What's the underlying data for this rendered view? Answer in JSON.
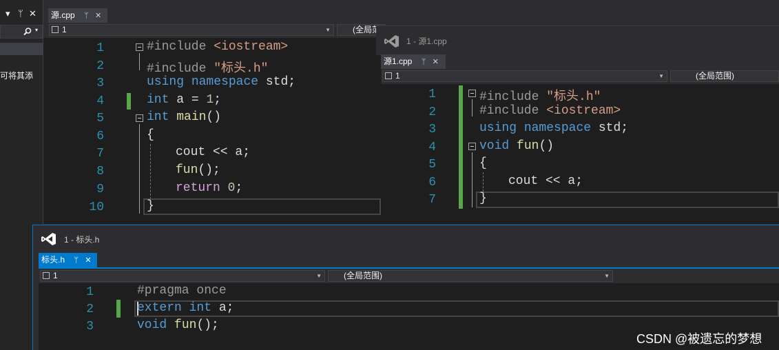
{
  "left_panel": {
    "header_icons": [
      "▾",
      "ᛘ",
      "✕"
    ],
    "text": "可将其添"
  },
  "main_editor": {
    "tab": "源.cpp",
    "dropdown": "1",
    "scope": "(全局范",
    "lines": [
      "1",
      "2",
      "3",
      "4",
      "5",
      "6",
      "7",
      "8",
      "9",
      "10"
    ]
  },
  "window_source1": {
    "title": "1 - 源1.cpp",
    "tab": "源1.cpp",
    "dropdown": "1",
    "scope": "(全局范围)",
    "lines": [
      "1",
      "2",
      "3",
      "4",
      "5",
      "6",
      "7"
    ]
  },
  "window_header": {
    "title": "1 - 标头.h",
    "tab": "标头.h",
    "dropdown": "1",
    "scope": "(全局范围)",
    "lines": [
      "1",
      "2",
      "3"
    ]
  },
  "code": {
    "include": "#include ",
    "iostream": "<iostream>",
    "header_str": "\"标头.h\"",
    "using": "using",
    "namespace": "namespace",
    "std": "std;",
    "int": "int",
    "a_eq": "a = ",
    "one": "1",
    "semi": ";",
    "main": "main",
    "paren": "()",
    "lbrace": "{",
    "rbrace": "}",
    "cout": "cout << a;",
    "fun": "fun",
    "fun_call_end": "();",
    "return": "return",
    "zero": "0",
    "void": "void",
    "pragma": "#pragma once",
    "extern": "extern",
    "a_semi": "a;"
  },
  "watermark": "CSDN @被遗忘的梦想",
  "colors": {
    "accent": "#007acc",
    "keyword": "#569cd6",
    "string": "#d69d85",
    "function": "#dcdcaa",
    "line_number": "#2b91af",
    "change_bar": "#57a64a"
  }
}
